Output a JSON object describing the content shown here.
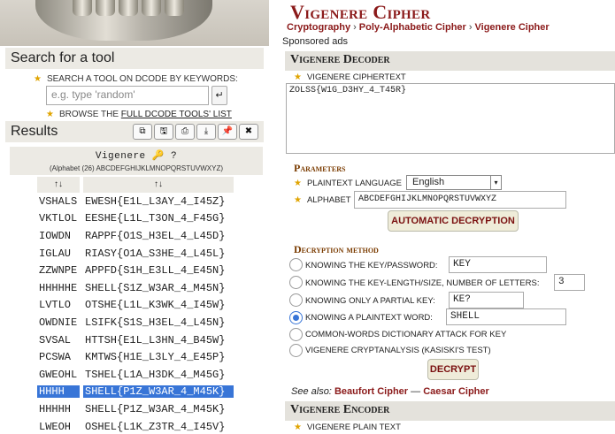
{
  "left": {
    "search_title": "Search for a tool",
    "search_hint": "Search a tool on dCode by keywords:",
    "search_placeholder": "e.g. type 'random'",
    "search_go": "↵",
    "browse_prefix": "Browse the",
    "browse_link": "full dCode tools' list",
    "results_title": "Results",
    "tool_icons": [
      "copy-icon",
      "save-icon",
      "print-icon",
      "download-icon",
      "pin-icon",
      "close-icon"
    ],
    "tool_glyphs": [
      "⧉",
      "🖫",
      "⎙",
      "⤓",
      "📌",
      "✖"
    ],
    "result_heading": "Vigenere 🔑 ?",
    "result_sub": "(Alphabet (26) ABCDEFGHIJKLMNOPQRSTUVWXYZ)",
    "col1_sort": "↑↓",
    "col2_sort": "↑↓",
    "rows": [
      {
        "key": "VSHALS",
        "text": "EWESH{E1L_L3AY_4_I45Z}"
      },
      {
        "key": "VKTLOL",
        "text": "EESHE{L1L_T3ON_4_F45G}"
      },
      {
        "key": "IOWDN",
        "text": "RAPPF{O1S_H3EL_4_L45D}"
      },
      {
        "key": "IGLAU",
        "text": "RIASY{O1A_S3HE_4_L45L}"
      },
      {
        "key": "ZZWNPE",
        "text": "APPFD{S1H_E3LL_4_E45N}"
      },
      {
        "key": "HHHHHE",
        "text": "SHELL{S1Z_W3AR_4_M45N}"
      },
      {
        "key": "LVTLO",
        "text": "OTSHE{L1L_K3WK_4_I45W}"
      },
      {
        "key": "OWDNIE",
        "text": "LSIFK{S1S_H3EL_4_L45N}"
      },
      {
        "key": "SVSAL",
        "text": "HTTSH{E1L_L3HN_4_B45W}"
      },
      {
        "key": "PCSWA",
        "text": "KMTWS{H1E_L3LY_4_E45P}"
      },
      {
        "key": "GWEOHL",
        "text": "TSHEL{L1A_H3DK_4_M45G}"
      },
      {
        "key": "HHHH",
        "text": "SHELL{P1Z_W3AR_4_M45K}",
        "selected": true
      },
      {
        "key": "HHHHH",
        "text": "SHELL{P1Z_W3AR_4_M45K}"
      },
      {
        "key": "LWEOH",
        "text": "OSHEL{L1K_Z3TR_4_I45V}"
      }
    ]
  },
  "right": {
    "title": "Vigenere Cipher",
    "crumbs": [
      "Cryptography",
      "Poly-Alphabetic Cipher",
      "Vigenere Cipher"
    ],
    "crumb_sep": "›",
    "sponsored": "Sponsored ads",
    "decoder_title": "Vigenere Decoder",
    "cipher_label": "Vigenere ciphertext",
    "ciphertext": "ZOLSS{W1G_D3HY_4_T45R}",
    "params_title": "Parameters",
    "lang_label": "Plaintext language",
    "lang_value": "English",
    "alpha_label": "Alphabet",
    "alpha_value": "ABCDEFGHIJKLMNOPQRSTUVWXYZ",
    "auto_btn": "AUTOMATIC DECRYPTION",
    "method_title": "Decryption method",
    "methods": [
      {
        "label": "Knowing the key/password:",
        "value": "KEY"
      },
      {
        "label": "Knowing the key-length/size, number of letters:",
        "value": "3"
      },
      {
        "label": "Knowing only a partial key:",
        "value": "KE?"
      },
      {
        "label": "Knowing a plaintext word:",
        "value": "SHELL",
        "selected": true
      },
      {
        "label": "Common-words dictionary attack for key"
      },
      {
        "label": "Vigenere cryptanalysis (Kasiski's test)"
      }
    ],
    "decrypt_btn": "DECRYPT",
    "seealso_prefix": "See also:",
    "seealso_links": [
      "Beaufort Cipher",
      "Caesar Cipher"
    ],
    "seealso_sep": "—",
    "encoder_title": "Vigenere Encoder",
    "plain_label": "Vigenere plain text"
  },
  "colors": {
    "accent": "#8b1a1a",
    "selection": "#3875d7",
    "star": "#e0a400"
  }
}
